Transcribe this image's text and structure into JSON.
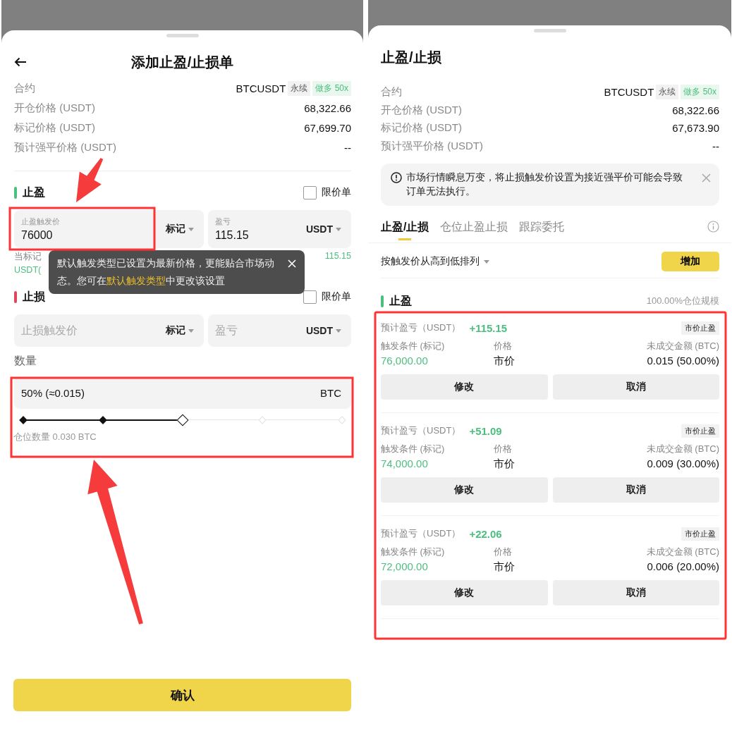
{
  "left_sheet": {
    "title": "添加止盈/止损单",
    "info": [
      {
        "label": "合约",
        "value": "BTCUSDT",
        "tags": [
          {
            "text": "永续",
            "kind": "neutral"
          },
          {
            "text": "做多 50x",
            "kind": "long"
          }
        ]
      },
      {
        "label": "开仓价格 (USDT)",
        "value": "68,322.66"
      },
      {
        "label": "标记价格 (USDT)",
        "value": "67,699.70"
      },
      {
        "label": "预计强平价格 (USDT)",
        "value": "--"
      }
    ],
    "sections": [
      {
        "title": "止盈",
        "kind": "profit",
        "limit_order": {
          "label": "限价单",
          "checked": false
        },
        "trigger_field": {
          "label": "止盈触发价",
          "value": "76000"
        },
        "trigger_type": "标记",
        "pnl_field": {
          "label": "盈亏",
          "value": "115.15"
        },
        "unit": "USDT",
        "hint": {
          "line_1": "当标记",
          "line_1_end": "115.15",
          "line_2": "USDT("
        }
      },
      {
        "title": "止损",
        "kind": "loss",
        "limit_order": {
          "label": "限价单",
          "checked": false
        },
        "trigger_field": {
          "placeholder": "止损触发价"
        },
        "trigger_type": "标记",
        "pnl_field": {
          "placeholder": "盈亏"
        },
        "unit": "USDT"
      }
    ],
    "tooltip": "默认触发类型已设置为最新价格，更能贴合市场动态。您可在**默认触发类型**中更改该设置",
    "quantity": {
      "label": "数量",
      "value": "50% (≈0.015)",
      "unit": "BTC",
      "level": 0.5,
      "position_size": "仓位数量 0.030 BTC"
    },
    "confirm_button": "确认"
  },
  "right_sheet": {
    "title": "止盈/止损",
    "info": [
      {
        "label": "合约",
        "value": "BTCUSDT",
        "tags": [
          {
            "text": "永续",
            "kind": "neutral"
          },
          {
            "text": "做多 50x",
            "kind": "long"
          }
        ]
      },
      {
        "label": "开仓价格 (USDT)",
        "value": "68,322.66"
      },
      {
        "label": "标记价格 (USDT)",
        "value": "67,673.90"
      },
      {
        "label": "预计强平价格 (USDT)",
        "value": "--"
      }
    ],
    "alert": "市场行情瞬息万变，将止损触发价设置为接近强平价可能会导致订单无法执行。",
    "tabs": [
      {
        "label": "止盈/止损",
        "selected": true
      },
      {
        "label": "仓位止盈止损",
        "selected": false
      },
      {
        "label": "跟踪委托",
        "selected": false
      }
    ],
    "sort": "按触发价从高到低排列",
    "add_button": "增加",
    "section": {
      "title": "止盈",
      "kind": "profit",
      "scale": "100.00%仓位规模"
    },
    "orders": [
      {
        "pnl_label": "预计盈亏（USDT）",
        "pnl": "+115.15",
        "type": "市价止盈",
        "trigger_label": "触发条件 (标记)",
        "trigger": "76,000.00",
        "price_label": "价格",
        "price": "市价",
        "amount_label": "未成交金额 (BTC)",
        "amount": "0.015 (50.00%)",
        "edit": "修改",
        "cancel": "取消"
      },
      {
        "pnl_label": "预计盈亏（USDT）",
        "pnl": "+51.09",
        "type": "市价止盈",
        "trigger_label": "触发条件 (标记)",
        "trigger": "74,000.00",
        "price_label": "价格",
        "price": "市价",
        "amount_label": "未成交金额 (BTC)",
        "amount": "0.009 (30.00%)",
        "edit": "修改",
        "cancel": "取消"
      },
      {
        "pnl_label": "预计盈亏（USDT）",
        "pnl": "+22.06",
        "type": "市价止盈",
        "trigger_label": "触发条件 (标记)",
        "trigger": "72,000.00",
        "price_label": "价格",
        "price": "市价",
        "amount_label": "未成交金额 (BTC)",
        "amount": "0.006 (20.00%)",
        "edit": "修改",
        "cancel": "取消"
      }
    ]
  }
}
